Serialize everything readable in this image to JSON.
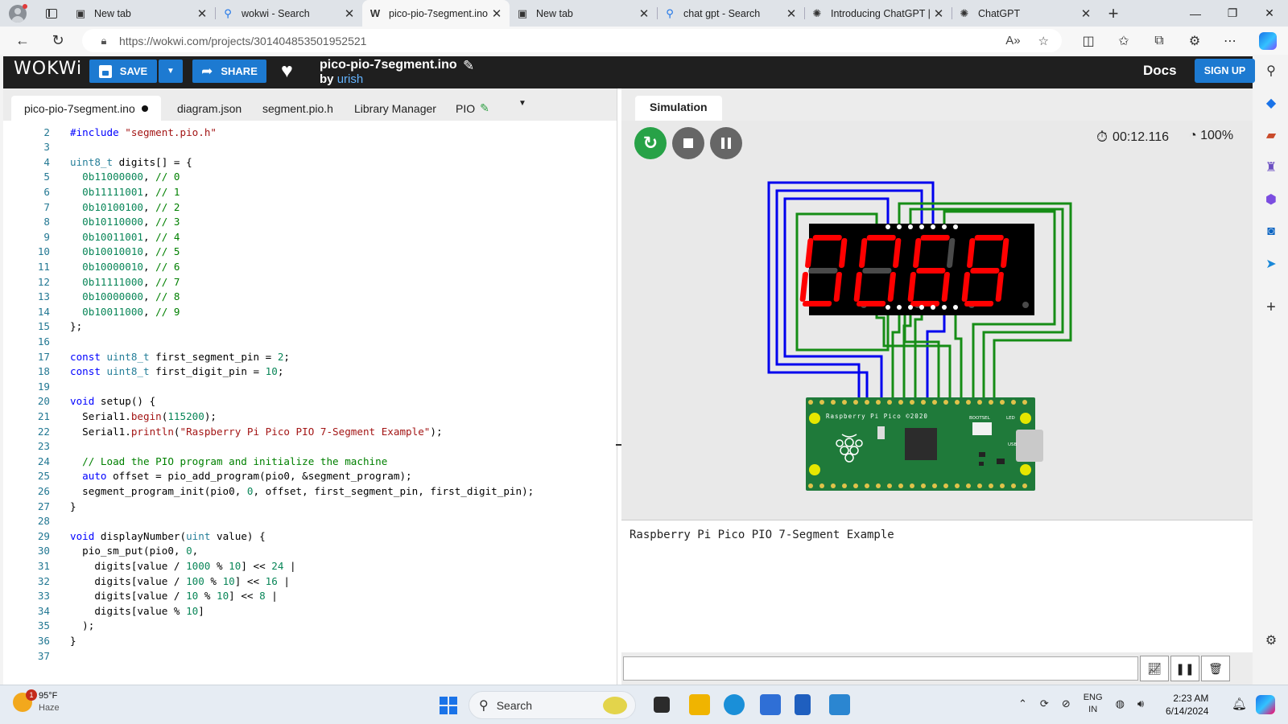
{
  "browser": {
    "tabs": [
      {
        "title": "New tab",
        "icon": "newtab-icon"
      },
      {
        "title": "wokwi - Search",
        "icon": "search-icon"
      },
      {
        "title": "pico-pio-7segment.ino",
        "icon": "wokwi-icon",
        "active": true
      },
      {
        "title": "New tab",
        "icon": "newtab-icon"
      },
      {
        "title": "chat gpt - Search",
        "icon": "search-icon"
      },
      {
        "title": "Introducing ChatGPT |",
        "icon": "openai-icon"
      },
      {
        "title": "ChatGPT",
        "icon": "openai-icon"
      }
    ],
    "url": "https://wokwi.com/projects/301404853501952521"
  },
  "wokwi": {
    "logo": "WOKWi",
    "save_label": "SAVE",
    "share_label": "SHARE",
    "project_title": "pico-pio-7segment.ino",
    "by_label": "by",
    "author": "urish",
    "docs_label": "Docs",
    "signup_label": "SIGN UP"
  },
  "editor": {
    "tabs": [
      "pico-pio-7segment.ino",
      "diagram.json",
      "segment.pio.h",
      "Library Manager",
      "PIO"
    ],
    "lines": [
      "",
      "#include \"segment.pio.h\"",
      "",
      "uint8_t digits[] = {",
      "  0b11000000, // 0",
      "  0b11111001, // 1",
      "  0b10100100, // 2",
      "  0b10110000, // 3",
      "  0b10011001, // 4",
      "  0b10010010, // 5",
      "  0b10000010, // 6",
      "  0b11111000, // 7",
      "  0b10000000, // 8",
      "  0b10011000, // 9",
      "};",
      "",
      "const uint8_t first_segment_pin = 2;",
      "const uint8_t first_digit_pin = 10;",
      "",
      "void setup() {",
      "  Serial1.begin(115200);",
      "  Serial1.println(\"Raspberry Pi Pico PIO 7-Segment Example\");",
      "",
      "  // Load the PIO program and initialize the machine",
      "  auto offset = pio_add_program(pio0, &segment_program);",
      "  segment_program_init(pio0, 0, offset, first_segment_pin, first_digit_pin);",
      "}",
      "",
      "void displayNumber(uint value) {",
      "  pio_sm_put(pio0, 0,",
      "    digits[value / 1000 % 10] << 24 |",
      "    digits[value / 100 % 10] << 16 |",
      "    digits[value / 10 % 10] << 8 |",
      "    digits[value % 10]",
      "  );",
      "}",
      ""
    ]
  },
  "simulation": {
    "tab_label": "Simulation",
    "timer": "00:12.116",
    "speed": "100%",
    "display_digits": "0068",
    "pico_label": "Raspberry Pi Pico ©2020",
    "bootsel_label": "BOOTSEL",
    "led_label": "LED",
    "usb_label": "USB",
    "serial_output": "Raspberry Pi Pico PIO 7-Segment Example"
  },
  "taskbar": {
    "weather_temp": "95°F",
    "weather_desc": "Haze",
    "weather_badge": "1",
    "search_placeholder": "Search",
    "lang_line1": "ENG",
    "lang_line2": "IN",
    "time": "2:23 AM",
    "date": "6/14/2024"
  },
  "colors": {
    "wokwi_header": "#1f1f1f",
    "accent_blue": "#1d7ad1",
    "segment_red": "#ff0000",
    "wire_blue": "#0000ee",
    "wire_green": "#168d16",
    "pico_green": "#1f7a3a"
  }
}
